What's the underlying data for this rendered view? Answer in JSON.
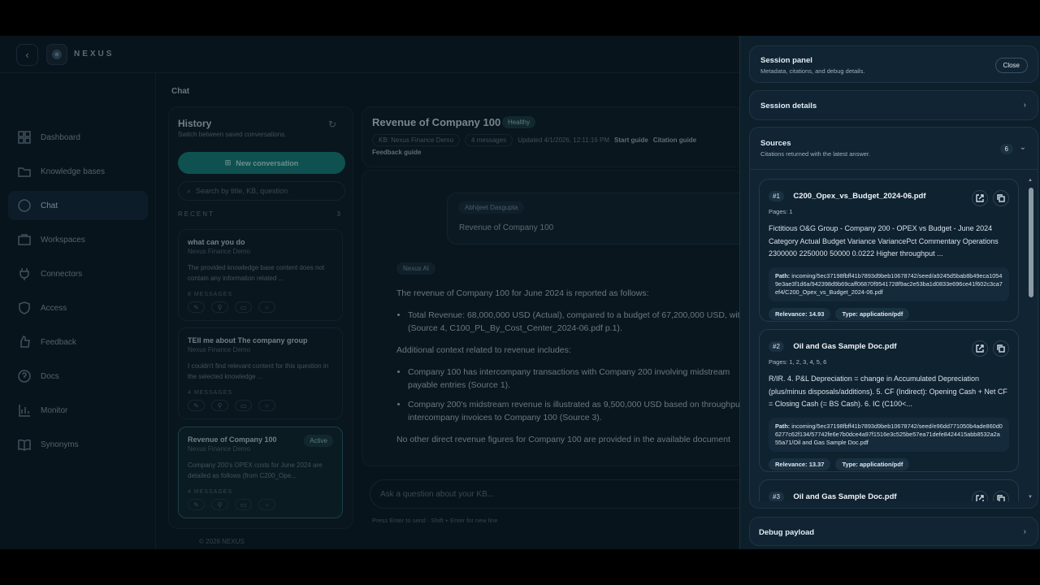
{
  "brand": "NEXUS",
  "page_title": "Chat",
  "footer": "© 2026 NEXUS",
  "sidebar": {
    "items": [
      {
        "label": "Dashboard",
        "icon": "dashboard-icon"
      },
      {
        "label": "Knowledge bases",
        "icon": "folder-icon"
      },
      {
        "label": "Chat",
        "icon": "chat-bubble-icon"
      },
      {
        "label": "Workspaces",
        "icon": "briefcase-icon"
      },
      {
        "label": "Connectors",
        "icon": "plug-icon"
      },
      {
        "label": "Access",
        "icon": "shield-icon"
      },
      {
        "label": "Feedback",
        "icon": "thumb-icon"
      },
      {
        "label": "Docs",
        "icon": "help-icon"
      },
      {
        "label": "Monitor",
        "icon": "bar-chart-icon"
      },
      {
        "label": "Synonyms",
        "icon": "book-icon"
      }
    ]
  },
  "history": {
    "title": "History",
    "subtitle": "Switch between saved conversations.",
    "new_button": "New conversation",
    "search_placeholder": "Search by title, KB, question",
    "recent_label": "RECENT",
    "recent_count": "3",
    "conversations": [
      {
        "title": "what can you do",
        "kb": "Nexus Finance Demo",
        "snippet": "The provided knowledge base content does not contain any information related ...",
        "messages": "8 MESSAGES"
      },
      {
        "title": "TEll me about The company group",
        "kb": "Nexus Finance Demo",
        "snippet": "I couldn't find relevant content for this question in the selected knowledge ...",
        "messages": "4 MESSAGES"
      },
      {
        "title": "Revenue of Company 100",
        "kb": "Nexus Finance Demo",
        "snippet": "Company 200's OPEX costs for June 2024 are detailed as follows (from C200_Ope...",
        "messages": "4 MESSAGES",
        "badge": "Active"
      }
    ]
  },
  "chat": {
    "title": "Revenue of Company 100",
    "status": "Healthy",
    "kb": "KB: Nexus Finance Demo",
    "messages": "4 messages",
    "updated": "Updated 4/1/2026, 12:11:16 PM",
    "start_guide": "Start guide",
    "citation_guide": "Citation guide",
    "feedback_guide": "Feedback guide",
    "user_name": "Abhijeet Dasgupta",
    "user_message": "Revenue of Company 100",
    "ai_name": "Nexus AI",
    "ai_p1": "The revenue of Company 100 for June 2024 is reported as follows:",
    "ai_b1": "Total Revenue: 68,000,000 USD (Actual), compared to a budget of 67,200,000 USD, wit",
    "ai_b1_cont": "(Source 4, C100_PL_By_Cost_Center_2024-06.pdf p.1).",
    "ai_p2": "Additional context related to revenue includes:",
    "ai_b2": "Company 100 has intercompany transactions with Company 200 involving midstream",
    "ai_b2_cont": "payable entries (Source 1).",
    "ai_b3": "Company 200's midstream revenue is illustrated as 9,500,000 USD based on throughpu",
    "ai_b3_cont": "intercompany invoices to Company 100 (Source 3).",
    "ai_p3": "No other direct revenue figures for Company 100 are provided in the available document",
    "composer_placeholder": "Ask a question about your KB...",
    "hint": "Press Enter to send · Shift + Enter for new line"
  },
  "panel": {
    "title": "Session panel",
    "subtitle": "Metadata, citations, and debug details.",
    "close": "Close",
    "session_details": "Session details",
    "sources_title": "Sources",
    "sources_sub": "Citations returned with the latest answer.",
    "sources_count": "6",
    "debug": "Debug payload",
    "sources": [
      {
        "num": "#1",
        "title": "C200_Opex_vs_Budget_2024-06.pdf",
        "pages": "Pages: 1",
        "text": "Fictitious O&G Group - Company 200 - OPEX vs Budget - June 2024 Category Actual Budget Variance VariancePct Commentary Operations 2300000 2250000 50000 0.0222 Higher throughput ...",
        "path_label": "Path:",
        "path": "incoming/5ec37198fbff41b7893d9beb10678742/seed/a9245d5bab8b49eca10549e3ae3f1d6a/942398d9b69caff06870f9541728f9ac2e53ba1d0833e696ce41f602c3ca7ef4/C200_Opex_vs_Budget_2024-06.pdf",
        "relevance": "Relevance: 14.93",
        "type": "Type: application/pdf"
      },
      {
        "num": "#2",
        "title": "Oil and Gas Sample Doc.pdf",
        "pages": "Pages: 1, 2, 3, 4, 5, 6",
        "text": "R/IR. 4. P&L Depreciation = change in Accumulated Depreciation (plus/minus disposals/additions). 5. CF (Indirect): Opening Cash + Net CF = Closing Cash (= BS Cash). 6. IC (C100<...",
        "path_label": "Path:",
        "path": "incoming/5ec37198fbff41b7893d9beb10678742/seed/e96dd771050b4ade860d06277c62f134/57742fe6e7b0dce4a97f1516e3c525be57ea71defe8424415abb8532a2a55a71/Oil and Gas Sample Doc.pdf",
        "relevance": "Relevance: 13.37",
        "type": "Type: application/pdf"
      },
      {
        "num": "#3",
        "title": "Oil and Gas Sample Doc.pdf"
      }
    ]
  }
}
